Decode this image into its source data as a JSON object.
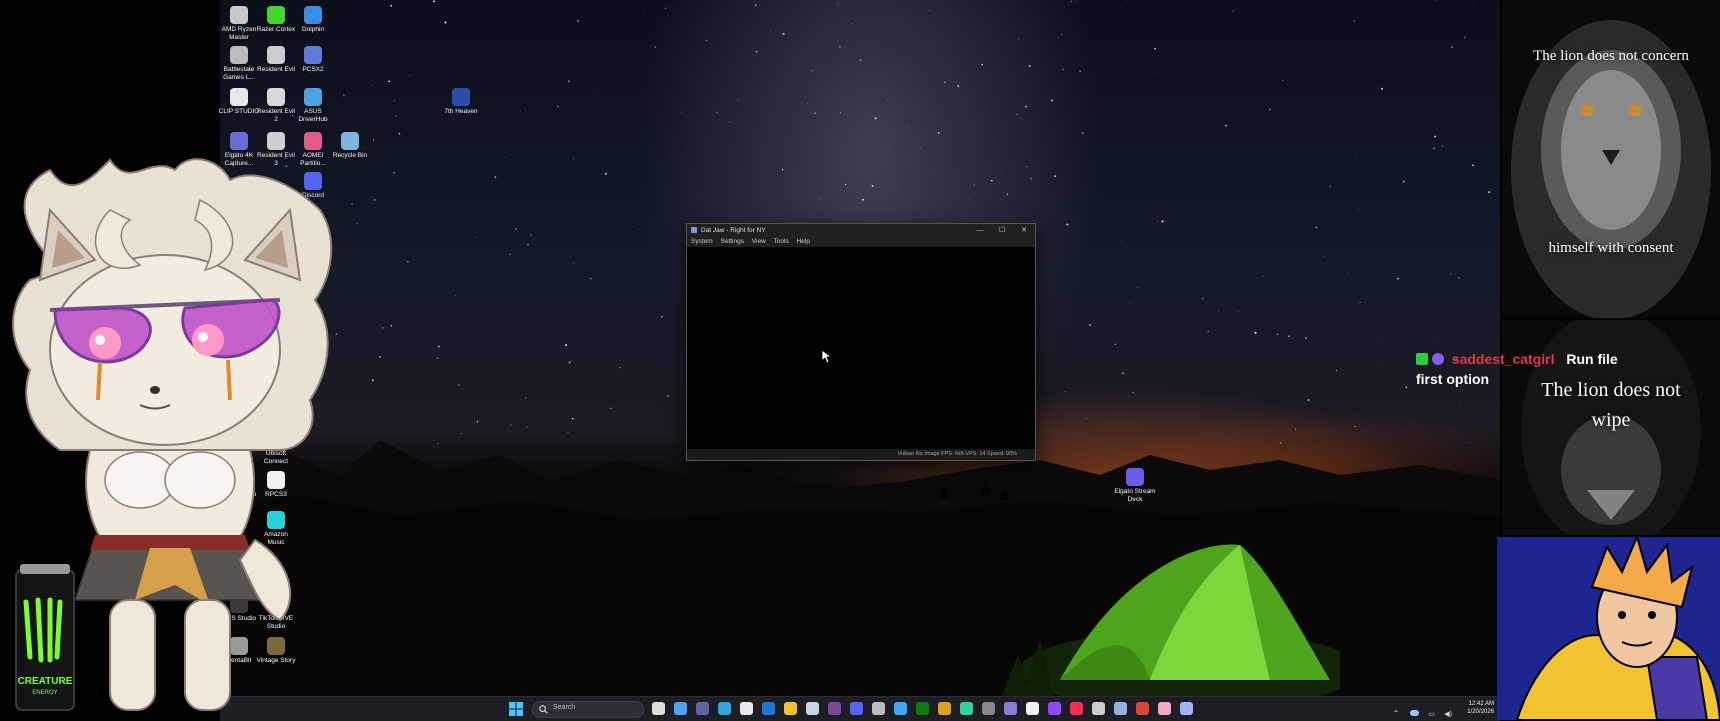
{
  "desktop": {
    "icons": [
      {
        "label": "AMD Ryzen Master",
        "icon": "amd-ryzen-icon",
        "color": "#c9c9c9"
      },
      {
        "label": "Razer Cortex",
        "icon": "razer-cortex-icon",
        "color": "#44d62c"
      },
      {
        "label": "Dolphin",
        "icon": "dolphin-icon",
        "color": "#3a8ee6"
      },
      {
        "label": "Battlestate Games L...",
        "icon": "battlestate-icon",
        "color": "#bbbbbb"
      },
      {
        "label": "Resident Evil",
        "icon": "resident-evil-icon",
        "color": "#cccccc"
      },
      {
        "label": "PCSX2",
        "icon": "pcsx2-icon",
        "color": "#5e7bd6"
      },
      {
        "label": "CLIP STUDIO",
        "icon": "clip-studio-icon",
        "color": "#e8e8e8"
      },
      {
        "label": "Resident Evil 2",
        "icon": "resident-evil-2-icon",
        "color": "#d9d9d9"
      },
      {
        "label": "ASUS DriverHub",
        "icon": "asus-driverhub-icon",
        "color": "#4aa3df"
      },
      {
        "label": "7th Heaven",
        "icon": "seventh-heaven-icon",
        "color": "#2b4ea8"
      },
      {
        "label": "Elgato 4K Capture...",
        "icon": "elgato-capture-icon",
        "color": "#6b6bd8"
      },
      {
        "label": "Resident Evil 3",
        "icon": "resident-evil-3-icon",
        "color": "#cfcfcf"
      },
      {
        "label": "AOMEI Partitio...",
        "icon": "aomei-icon",
        "color": "#e05a8a"
      },
      {
        "label": "Recycle Bin",
        "icon": "recycle-bin-icon",
        "color": "#7fb3e0"
      },
      {
        "label": "Discord",
        "icon": "discord-icon",
        "color": "#5865f2"
      },
      {
        "label": "Ubisoft Connect",
        "icon": "ubisoft-icon",
        "color": "#dcdcdc"
      },
      {
        "label": "RPCS3",
        "icon": "rpcs3-icon",
        "color": "#f0f0f0"
      },
      {
        "label": "NVIDIA App",
        "icon": "nvidia-icon",
        "color": "#76b900"
      },
      {
        "label": "Amazon Music",
        "icon": "amazon-music-icon",
        "color": "#25d1da"
      },
      {
        "label": "OBS Studio",
        "icon": "obs-icon",
        "color": "#3a3a3a"
      },
      {
        "label": "TikTok LIVE Studio",
        "icon": "tiktok-live-icon",
        "color": "#fe2c55"
      },
      {
        "label": "PentaBit",
        "icon": "pentabit-icon",
        "color": "#999999"
      },
      {
        "label": "Vintage Story",
        "icon": "vintage-story-icon",
        "color": "#7a6a3a"
      },
      {
        "label": "Elgato Stream Deck",
        "icon": "stream-deck-icon",
        "color": "#6b5ce7"
      }
    ]
  },
  "window": {
    "title": "Dat Jaw - Right for NY",
    "menu": [
      "System",
      "Settings",
      "View",
      "Tools",
      "Help"
    ],
    "status": "Vulkan    No Image FPS: N/A VPS: 14  Speed: 90%",
    "minimize_glyph": "—",
    "maximize_glyph": "☐",
    "close_glyph": "✕"
  },
  "taskbar": {
    "search_placeholder": "Search",
    "time": "12:42 AM",
    "date": "1/20/2026",
    "apps": [
      {
        "icon": "task-view-icon",
        "color": "#dddddd"
      },
      {
        "icon": "copilot-icon",
        "color": "#4fa3f7"
      },
      {
        "icon": "teams-icon",
        "color": "#6264a7"
      },
      {
        "icon": "edge-icon",
        "color": "#2fa4de"
      },
      {
        "icon": "store-icon",
        "color": "#e8e8e8"
      },
      {
        "icon": "outlook-icon",
        "color": "#1b7bd4"
      },
      {
        "icon": "file-explorer-icon",
        "color": "#f1c232"
      },
      {
        "icon": "steam-icon",
        "color": "#c7d5e0"
      },
      {
        "icon": "tor-icon",
        "color": "#7d4698"
      },
      {
        "icon": "discord-icon",
        "color": "#5865f2"
      },
      {
        "icon": "obs-icon",
        "color": "#bbbbbb"
      },
      {
        "icon": "photos-icon",
        "color": "#3fa9f5"
      },
      {
        "icon": "xbox-icon",
        "color": "#107c10"
      },
      {
        "icon": "chrome-icon",
        "color": "#e0a020"
      },
      {
        "icon": "clip-studio-icon",
        "color": "#35d0a0"
      },
      {
        "icon": "capture-icon",
        "color": "#888888"
      },
      {
        "icon": "calculator-icon",
        "color": "#8c7bd6"
      },
      {
        "icon": "amazon-icon",
        "color": "#f0f0f0"
      },
      {
        "icon": "twitch-icon",
        "color": "#9146ff"
      },
      {
        "icon": "tiktok-icon",
        "color": "#fe2c55"
      },
      {
        "icon": "rpcs3-icon",
        "color": "#cccccc"
      },
      {
        "icon": "steam-2-icon",
        "color": "#8fb3d9"
      },
      {
        "icon": "chrome-2-icon",
        "color": "#db4437"
      },
      {
        "icon": "paint-icon",
        "color": "#f7a7c7"
      },
      {
        "icon": "gear-icon",
        "color": "#a0b4ff"
      }
    ]
  },
  "overlays": {
    "lion_top_caption_1": "The lion does not concern",
    "lion_top_caption_2": "himself with consent",
    "lion_bottom_caption": "The lion does not wipe",
    "chat": {
      "username": "saddest_catgirl",
      "message_part1": "Run file",
      "message_part2": "first option",
      "badge_colors": [
        "#2ecc40",
        "#8a5cf6"
      ]
    },
    "monster_text": "CREATURE",
    "monster_sub": "ENERGY"
  }
}
